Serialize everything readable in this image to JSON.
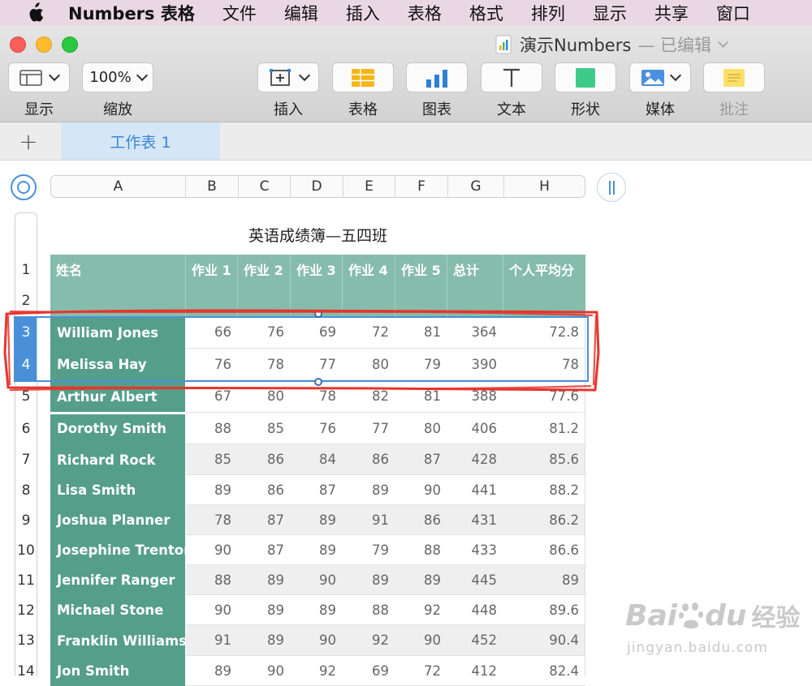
{
  "menubar": {
    "app": "Numbers 表格",
    "items": [
      "文件",
      "编辑",
      "插入",
      "表格",
      "格式",
      "排列",
      "显示",
      "共享",
      "窗口"
    ]
  },
  "window": {
    "title": "演示Numbers",
    "status": "— 已编辑"
  },
  "toolbar": {
    "view_label": "显示",
    "zoom_value": "100%",
    "zoom_label": "缩放",
    "insert_label": "插入",
    "table_label": "表格",
    "chart_label": "图表",
    "text_label": "文本",
    "shape_label": "形状",
    "media_label": "媒体",
    "comment_label": "批注"
  },
  "tabs": {
    "add": "+",
    "active": "工作表 1"
  },
  "sheet": {
    "columns": [
      "A",
      "B",
      "C",
      "D",
      "E",
      "F",
      "G",
      "H"
    ],
    "row_numbers": [
      "1",
      "2",
      "3",
      "4",
      "5",
      "6",
      "7",
      "8",
      "9",
      "10",
      "11",
      "12",
      "13",
      "14"
    ],
    "title": "英语成绩簿—五四班",
    "headers": [
      "姓名",
      "作业 1",
      "作业 2",
      "作业 3",
      "作业 4",
      "作业 5",
      "总计",
      "个人平均分"
    ],
    "rows": [
      {
        "name": "William Jones",
        "values": [
          "66",
          "76",
          "69",
          "72",
          "81",
          "364",
          "72.8"
        ]
      },
      {
        "name": "Melissa Hay",
        "values": [
          "76",
          "78",
          "77",
          "80",
          "79",
          "390",
          "78"
        ]
      },
      {
        "name": "Arthur Albert",
        "values": [
          "67",
          "80",
          "78",
          "82",
          "81",
          "388",
          "77.6"
        ]
      },
      {
        "name": "Dorothy Smith",
        "values": [
          "88",
          "85",
          "76",
          "77",
          "80",
          "406",
          "81.2"
        ]
      },
      {
        "name": "Richard Rock",
        "values": [
          "85",
          "86",
          "84",
          "86",
          "87",
          "428",
          "85.6"
        ]
      },
      {
        "name": "Lisa Smith",
        "values": [
          "89",
          "86",
          "87",
          "89",
          "90",
          "441",
          "88.2"
        ]
      },
      {
        "name": "Joshua Planner",
        "values": [
          "78",
          "87",
          "89",
          "91",
          "86",
          "431",
          "86.2"
        ]
      },
      {
        "name": "Josephine Trenton",
        "values": [
          "90",
          "87",
          "89",
          "79",
          "88",
          "433",
          "86.6"
        ]
      },
      {
        "name": "Jennifer Ranger",
        "values": [
          "88",
          "89",
          "90",
          "89",
          "89",
          "445",
          "89"
        ]
      },
      {
        "name": "Michael Stone",
        "values": [
          "90",
          "89",
          "89",
          "88",
          "92",
          "448",
          "89.6"
        ]
      },
      {
        "name": "Franklin Williams",
        "values": [
          "91",
          "89",
          "90",
          "92",
          "90",
          "452",
          "90.4"
        ]
      },
      {
        "name": "Jon Smith",
        "values": [
          "89",
          "90",
          "92",
          "69",
          "72",
          "412",
          "82.4"
        ]
      }
    ],
    "selected_rows": [
      "3",
      "4"
    ]
  },
  "watermark": {
    "brand": "Bai",
    "brand2": "du",
    "cn": "经验",
    "url": "jingyan.baidu.com"
  },
  "colors": {
    "menubar": "#ead7e4",
    "header_fill": "#86bcab",
    "name_fill": "#559e8a",
    "selection": "#4a90d9",
    "annotation": "#e8342c",
    "zebra": "#efefef"
  },
  "icons": [
    "apple-icon",
    "sidebar-view-icon",
    "insert-icon",
    "table-icon",
    "chart-icon",
    "text-icon",
    "shape-icon",
    "media-icon",
    "comment-icon",
    "numbers-doc-icon"
  ]
}
